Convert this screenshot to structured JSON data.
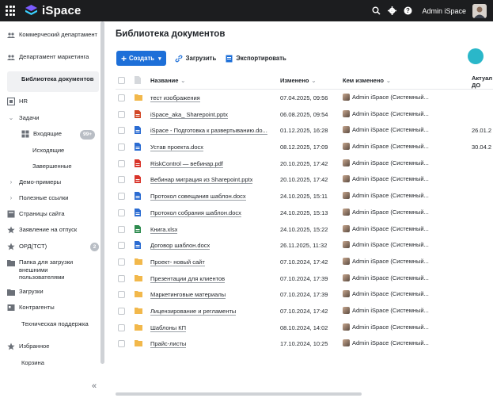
{
  "app": {
    "name": "iSpace",
    "user_name": "Admin iSpace"
  },
  "colors": {
    "topbar": "#1c1d1f",
    "accent": "#1d6fd8",
    "folder": "#f2b84b",
    "word": "#2b6cd2",
    "pdf": "#d9352b",
    "excel": "#2e8b4f",
    "powerpoint": "#d24726",
    "avatar_circle": "#2ab7c9"
  },
  "sidebar": {
    "items": [
      {
        "label": "Коммерческий департамент",
        "icon": "group-icon"
      },
      {
        "label": "Департамент маркетинга",
        "icon": "group-icon"
      },
      {
        "label": "Библиотека документов",
        "icon": ""
      },
      {
        "label": "HR",
        "icon": "hr-icon"
      },
      {
        "label": "Задачи",
        "icon": "chevron-down-icon"
      },
      {
        "label": "Входящие",
        "icon": "inbox-icon",
        "badge": "99+"
      },
      {
        "label": "Исходящие",
        "icon": ""
      },
      {
        "label": "Завершенные",
        "icon": ""
      },
      {
        "label": "Демо-примеры",
        "icon": "chevron-right-icon"
      },
      {
        "label": "Полезные ссылки",
        "icon": "chevron-right-icon"
      },
      {
        "label": "Страницы сайта",
        "icon": "pages-icon"
      },
      {
        "label": "Заявление на отпуск",
        "icon": "star-icon"
      },
      {
        "label": "ОРД(ТСТ)",
        "icon": "star-icon",
        "badge": "2"
      },
      {
        "label": "Папка для загрузки внешними пользователями",
        "icon": "folder-icon"
      },
      {
        "label": "Загрузки",
        "icon": "downloads-icon"
      },
      {
        "label": "Контрагенты",
        "icon": "contacts-icon"
      },
      {
        "label": "Техническая поддержка",
        "icon": ""
      },
      {
        "label": "Избранное",
        "icon": "star-icon"
      },
      {
        "label": "Корзина",
        "icon": ""
      }
    ],
    "collapse_label": "«"
  },
  "main": {
    "title": "Библиотека документов",
    "toolbar": {
      "create_label": "Создать",
      "upload_label": "Загрузить",
      "export_label": "Экспортировать"
    },
    "columns": {
      "name": "Название",
      "modified": "Изменено",
      "modified_by": "Кем изменено",
      "actual": "Актуал ДО"
    },
    "rows": [
      {
        "type": "folder",
        "name": "тест изображения",
        "modified": "07.04.2025, 09:56",
        "by": "Admin iSpace (Системный...",
        "actual": ""
      },
      {
        "type": "ppt",
        "name": "iSpace_aka_ Sharepoint.pptx",
        "modified": "06.08.2025, 09:54",
        "by": "Admin iSpace (Системный...",
        "actual": ""
      },
      {
        "type": "word",
        "name": "iSpace - Подготовка к развертыванию.do...",
        "modified": "01.12.2025, 16:28",
        "by": "Admin iSpace (Системный...",
        "actual": "26.01.2"
      },
      {
        "type": "word",
        "name": "Устав проекта.docx",
        "modified": "08.12.2025, 17:09",
        "by": "Admin iSpace (Системный...",
        "actual": "30.04.2"
      },
      {
        "type": "pdf",
        "name": "RiskControl — вебинар.pdf",
        "modified": "20.10.2025, 17:42",
        "by": "Admin iSpace (Системный...",
        "actual": ""
      },
      {
        "type": "pdf",
        "name": "Вебинар миграция из Sharepoint.pptx",
        "modified": "20.10.2025, 17:42",
        "by": "Admin iSpace (Системный...",
        "actual": ""
      },
      {
        "type": "word",
        "name": "Протокол совещания шаблон.docx",
        "modified": "24.10.2025, 15:11",
        "by": "Admin iSpace (Системный...",
        "actual": ""
      },
      {
        "type": "word",
        "name": "Протокол собрания шаблон.docx",
        "modified": "24.10.2025, 15:13",
        "by": "Admin iSpace (Системный...",
        "actual": ""
      },
      {
        "type": "excel",
        "name": "Книга.xlsx",
        "modified": "24.10.2025, 15:22",
        "by": "Admin iSpace (Системный...",
        "actual": ""
      },
      {
        "type": "word",
        "name": "Договор шаблон.docx",
        "modified": "26.11.2025, 11:32",
        "by": "Admin iSpace (Системный...",
        "actual": ""
      },
      {
        "type": "folder",
        "name": "Проект- новый сайт",
        "modified": "07.10.2024, 17:42",
        "by": "Admin iSpace (Системный...",
        "actual": ""
      },
      {
        "type": "folder",
        "name": "Презентации для клиентов",
        "modified": "07.10.2024, 17:39",
        "by": "Admin iSpace (Системный...",
        "actual": ""
      },
      {
        "type": "folder",
        "name": "Маркетинговые материалы",
        "modified": "07.10.2024, 17:39",
        "by": "Admin iSpace (Системный...",
        "actual": ""
      },
      {
        "type": "folder",
        "name": "Лицензирование и регламенты",
        "modified": "07.10.2024, 17:42",
        "by": "Admin iSpace (Системный...",
        "actual": ""
      },
      {
        "type": "folder",
        "name": "Шаблоны КП",
        "modified": "08.10.2024, 14:02",
        "by": "Admin iSpace (Системный...",
        "actual": ""
      },
      {
        "type": "folder",
        "name": "Прайс-листы",
        "modified": "17.10.2024, 10:25",
        "by": "Admin iSpace (Системный...",
        "actual": ""
      }
    ]
  }
}
